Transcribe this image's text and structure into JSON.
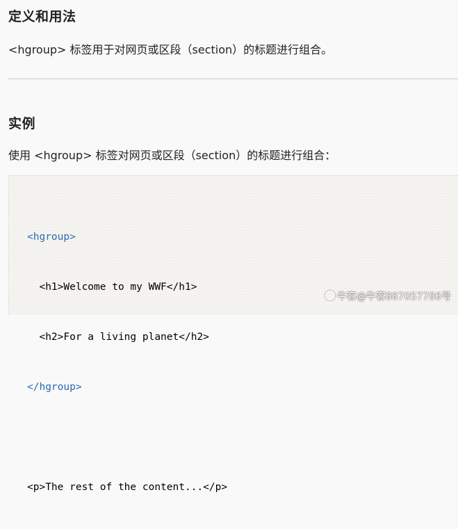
{
  "sections": {
    "definition": {
      "title": "定义和用法",
      "text": "<hgroup> 标签用于对网页或区段（section）的标题进行组合。"
    },
    "example": {
      "title": "实例",
      "text": "使用 <hgroup> 标签对网页或区段（section）的标题进行组合："
    }
  },
  "code": {
    "lines": [
      "<hgroup>",
      "  <h1>Welcome to my WWF</h1>",
      "  <h2>For a living planet</h2>",
      "</hgroup>",
      "",
      "<p>The rest of the content...</p>"
    ]
  },
  "watermark": {
    "text": "牛客@牛客887057786号"
  },
  "colors": {
    "tag_blue": "#2a6bb0",
    "text": "#222222",
    "divider": "#c8c8c8"
  }
}
